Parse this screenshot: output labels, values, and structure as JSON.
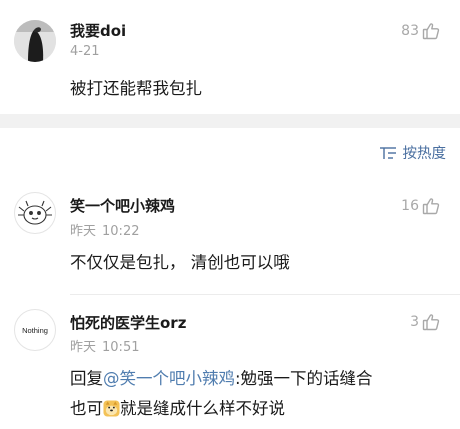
{
  "comments": [
    {
      "username": "我要doi",
      "time": "4-21",
      "likes": "83",
      "text": "被打还能帮我包扎"
    },
    {
      "username": "笑一个吧小辣鸡",
      "date_label": "昨天",
      "time": "10:22",
      "likes": "16",
      "text": "不仅仅是包扎，  清创也可以哦"
    },
    {
      "username": "怕死的医学生orz",
      "date_label": "昨天",
      "time": "10:51",
      "likes": "3",
      "reply_prefix": "回复",
      "mention": "@笑一个吧小辣鸡",
      "text_line1": ":勉强一下的话缝合",
      "text_line2_a": "也可",
      "text_line2_b": "就是缝成什么样不好说",
      "avatar_text": "Nothing"
    }
  ],
  "sort": {
    "label": "按热度"
  },
  "icons": {
    "like": "thumbs-up-icon",
    "sort": "sort-icon",
    "emoji": "doge-emoji-icon"
  },
  "colors": {
    "link": "#507daf",
    "sort": "#4a6fa0",
    "meta": "#a0a0a0",
    "separator": "#f1f1f1"
  }
}
